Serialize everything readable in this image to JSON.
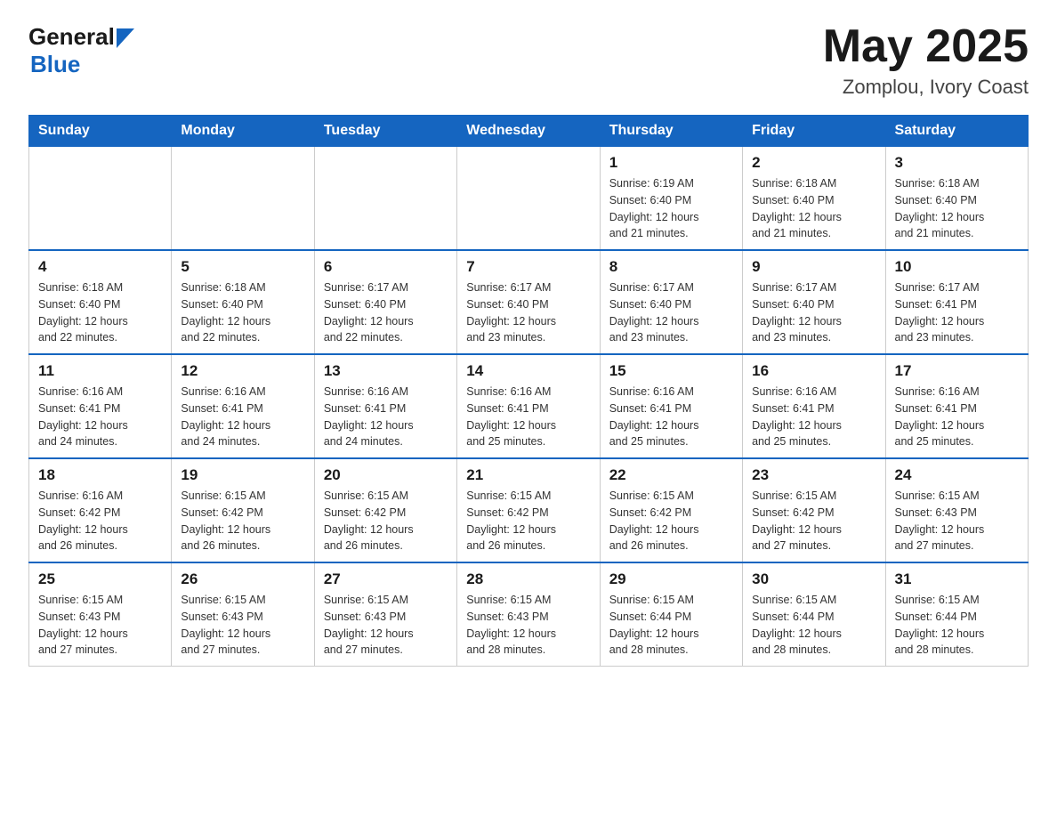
{
  "header": {
    "logo_general": "General",
    "logo_blue": "Blue",
    "month": "May 2025",
    "location": "Zomplou, Ivory Coast"
  },
  "weekdays": [
    "Sunday",
    "Monday",
    "Tuesday",
    "Wednesday",
    "Thursday",
    "Friday",
    "Saturday"
  ],
  "weeks": [
    [
      {
        "day": "",
        "info": ""
      },
      {
        "day": "",
        "info": ""
      },
      {
        "day": "",
        "info": ""
      },
      {
        "day": "",
        "info": ""
      },
      {
        "day": "1",
        "info": "Sunrise: 6:19 AM\nSunset: 6:40 PM\nDaylight: 12 hours\nand 21 minutes."
      },
      {
        "day": "2",
        "info": "Sunrise: 6:18 AM\nSunset: 6:40 PM\nDaylight: 12 hours\nand 21 minutes."
      },
      {
        "day": "3",
        "info": "Sunrise: 6:18 AM\nSunset: 6:40 PM\nDaylight: 12 hours\nand 21 minutes."
      }
    ],
    [
      {
        "day": "4",
        "info": "Sunrise: 6:18 AM\nSunset: 6:40 PM\nDaylight: 12 hours\nand 22 minutes."
      },
      {
        "day": "5",
        "info": "Sunrise: 6:18 AM\nSunset: 6:40 PM\nDaylight: 12 hours\nand 22 minutes."
      },
      {
        "day": "6",
        "info": "Sunrise: 6:17 AM\nSunset: 6:40 PM\nDaylight: 12 hours\nand 22 minutes."
      },
      {
        "day": "7",
        "info": "Sunrise: 6:17 AM\nSunset: 6:40 PM\nDaylight: 12 hours\nand 23 minutes."
      },
      {
        "day": "8",
        "info": "Sunrise: 6:17 AM\nSunset: 6:40 PM\nDaylight: 12 hours\nand 23 minutes."
      },
      {
        "day": "9",
        "info": "Sunrise: 6:17 AM\nSunset: 6:40 PM\nDaylight: 12 hours\nand 23 minutes."
      },
      {
        "day": "10",
        "info": "Sunrise: 6:17 AM\nSunset: 6:41 PM\nDaylight: 12 hours\nand 23 minutes."
      }
    ],
    [
      {
        "day": "11",
        "info": "Sunrise: 6:16 AM\nSunset: 6:41 PM\nDaylight: 12 hours\nand 24 minutes."
      },
      {
        "day": "12",
        "info": "Sunrise: 6:16 AM\nSunset: 6:41 PM\nDaylight: 12 hours\nand 24 minutes."
      },
      {
        "day": "13",
        "info": "Sunrise: 6:16 AM\nSunset: 6:41 PM\nDaylight: 12 hours\nand 24 minutes."
      },
      {
        "day": "14",
        "info": "Sunrise: 6:16 AM\nSunset: 6:41 PM\nDaylight: 12 hours\nand 25 minutes."
      },
      {
        "day": "15",
        "info": "Sunrise: 6:16 AM\nSunset: 6:41 PM\nDaylight: 12 hours\nand 25 minutes."
      },
      {
        "day": "16",
        "info": "Sunrise: 6:16 AM\nSunset: 6:41 PM\nDaylight: 12 hours\nand 25 minutes."
      },
      {
        "day": "17",
        "info": "Sunrise: 6:16 AM\nSunset: 6:41 PM\nDaylight: 12 hours\nand 25 minutes."
      }
    ],
    [
      {
        "day": "18",
        "info": "Sunrise: 6:16 AM\nSunset: 6:42 PM\nDaylight: 12 hours\nand 26 minutes."
      },
      {
        "day": "19",
        "info": "Sunrise: 6:15 AM\nSunset: 6:42 PM\nDaylight: 12 hours\nand 26 minutes."
      },
      {
        "day": "20",
        "info": "Sunrise: 6:15 AM\nSunset: 6:42 PM\nDaylight: 12 hours\nand 26 minutes."
      },
      {
        "day": "21",
        "info": "Sunrise: 6:15 AM\nSunset: 6:42 PM\nDaylight: 12 hours\nand 26 minutes."
      },
      {
        "day": "22",
        "info": "Sunrise: 6:15 AM\nSunset: 6:42 PM\nDaylight: 12 hours\nand 26 minutes."
      },
      {
        "day": "23",
        "info": "Sunrise: 6:15 AM\nSunset: 6:42 PM\nDaylight: 12 hours\nand 27 minutes."
      },
      {
        "day": "24",
        "info": "Sunrise: 6:15 AM\nSunset: 6:43 PM\nDaylight: 12 hours\nand 27 minutes."
      }
    ],
    [
      {
        "day": "25",
        "info": "Sunrise: 6:15 AM\nSunset: 6:43 PM\nDaylight: 12 hours\nand 27 minutes."
      },
      {
        "day": "26",
        "info": "Sunrise: 6:15 AM\nSunset: 6:43 PM\nDaylight: 12 hours\nand 27 minutes."
      },
      {
        "day": "27",
        "info": "Sunrise: 6:15 AM\nSunset: 6:43 PM\nDaylight: 12 hours\nand 27 minutes."
      },
      {
        "day": "28",
        "info": "Sunrise: 6:15 AM\nSunset: 6:43 PM\nDaylight: 12 hours\nand 28 minutes."
      },
      {
        "day": "29",
        "info": "Sunrise: 6:15 AM\nSunset: 6:44 PM\nDaylight: 12 hours\nand 28 minutes."
      },
      {
        "day": "30",
        "info": "Sunrise: 6:15 AM\nSunset: 6:44 PM\nDaylight: 12 hours\nand 28 minutes."
      },
      {
        "day": "31",
        "info": "Sunrise: 6:15 AM\nSunset: 6:44 PM\nDaylight: 12 hours\nand 28 minutes."
      }
    ]
  ]
}
